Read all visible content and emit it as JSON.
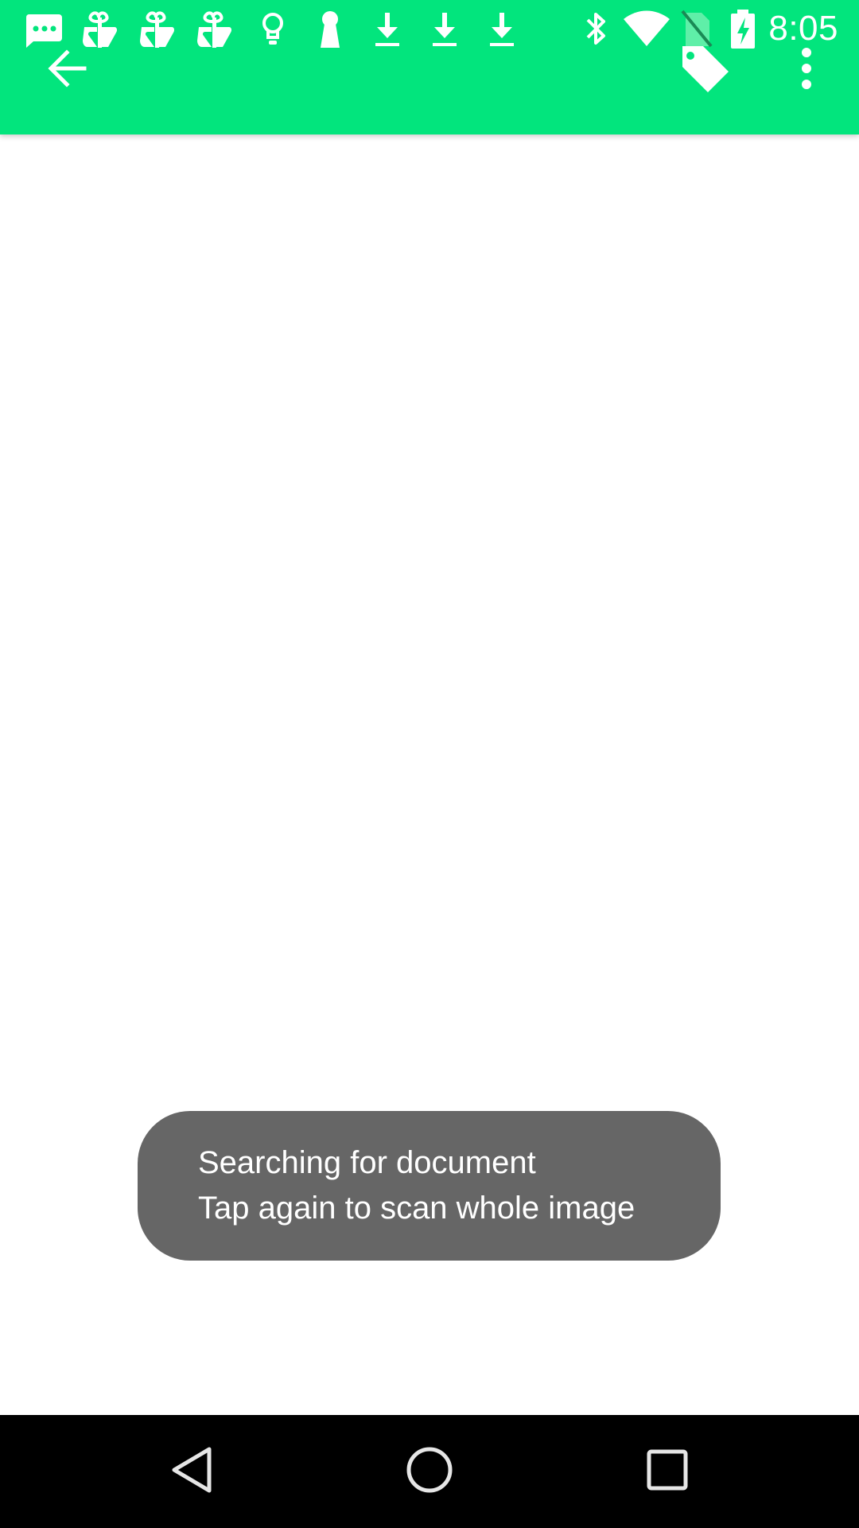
{
  "colors": {
    "app_bar": "#02E57D",
    "status_bar_accent": "#1A8A55",
    "icon": "#FFFFFF",
    "toast_bg": "#666666",
    "nav_bar": "#000000",
    "nav_icon": "#E6E6E6"
  },
  "status_bar": {
    "time": "8:05",
    "notification_icons": [
      "chat-bubble-icon",
      "gift-icon",
      "gift-icon",
      "gift-icon",
      "lightbulb-icon",
      "keyhole-icon",
      "download-icon",
      "download-icon",
      "download-icon"
    ],
    "system_icons": [
      "bluetooth-icon",
      "wifi-icon",
      "no-sim-icon",
      "battery-charging-icon"
    ]
  },
  "toolbar": {
    "back_icon": "arrow-back-icon",
    "tag_icon": "tag-icon",
    "overflow_icon": "more-vert-icon"
  },
  "toast": {
    "line1": "Searching for document",
    "line2": "Tap again to scan whole image"
  },
  "nav_bar": {
    "back_icon": "nav-back-icon",
    "home_icon": "nav-home-icon",
    "recents_icon": "nav-recents-icon"
  }
}
